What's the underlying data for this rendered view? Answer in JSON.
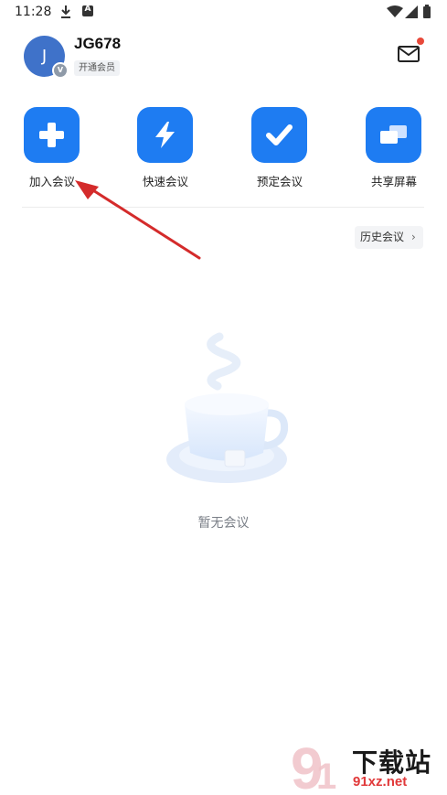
{
  "status_bar": {
    "time": "11:28",
    "icons": [
      "download-icon",
      "a-icon",
      "wifi-icon",
      "signal-icon",
      "battery-icon"
    ]
  },
  "profile": {
    "avatar_letter": "J",
    "avatar_badge": "V",
    "username": "JG678",
    "member_label": "开通会员",
    "avatar_color": "#3f72c9"
  },
  "mail": {
    "icon": "mail-icon",
    "has_notification": true,
    "notification_color": "#e8493a"
  },
  "actions": [
    {
      "label": "加入会议",
      "icon": "plus-icon"
    },
    {
      "label": "快速会议",
      "icon": "lightning-icon"
    },
    {
      "label": "预定会议",
      "icon": "check-icon"
    },
    {
      "label": "共享屏幕",
      "icon": "share-screen-icon"
    }
  ],
  "accent_color": "#1e7cf2",
  "history": {
    "label": "历史会议",
    "chevron": "›"
  },
  "empty_state": {
    "text": "暂无会议",
    "illustration": "coffee-cup-illustration"
  },
  "annotation": {
    "type": "red-arrow",
    "color": "#d42b2b"
  },
  "watermark": {
    "title": "下载站",
    "url": "91xz.net",
    "logo": "9-logo"
  }
}
